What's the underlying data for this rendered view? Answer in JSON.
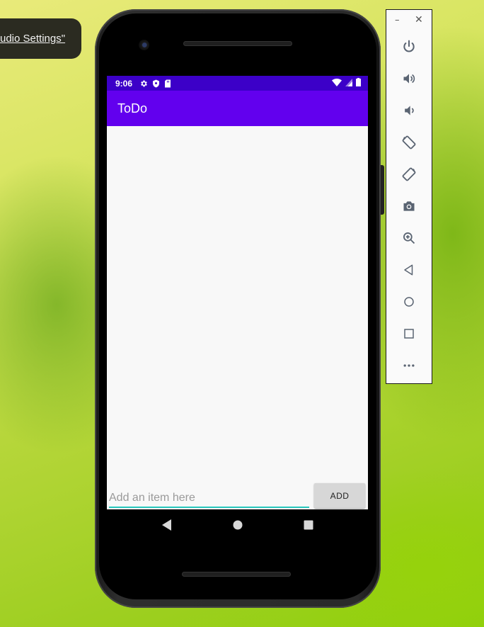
{
  "notification": {
    "text": "udio Settings\""
  },
  "status_bar": {
    "time": "9:06"
  },
  "app": {
    "title": "ToDo",
    "input_placeholder": "Add an item here",
    "input_value": "",
    "add_button_label": "ADD",
    "colors": {
      "app_bar": "#6200ee",
      "status_bar": "#3c00c8",
      "input_underline": "#26c6bc"
    }
  },
  "navigation": {
    "buttons": [
      {
        "icon": "back-triangle-icon"
      },
      {
        "icon": "home-circle-icon"
      },
      {
        "icon": "recents-square-icon"
      }
    ]
  },
  "emulator_toolbar": {
    "window_controls": {
      "minimize": "–",
      "close": "✕"
    },
    "tools": [
      {
        "icon": "power-icon"
      },
      {
        "icon": "volume-up-icon"
      },
      {
        "icon": "volume-down-icon"
      },
      {
        "icon": "rotate-left-icon"
      },
      {
        "icon": "rotate-right-icon"
      },
      {
        "icon": "camera-icon"
      },
      {
        "icon": "zoom-icon"
      },
      {
        "icon": "back-icon"
      },
      {
        "icon": "home-icon"
      },
      {
        "icon": "overview-icon"
      },
      {
        "icon": "more-icon"
      }
    ]
  }
}
